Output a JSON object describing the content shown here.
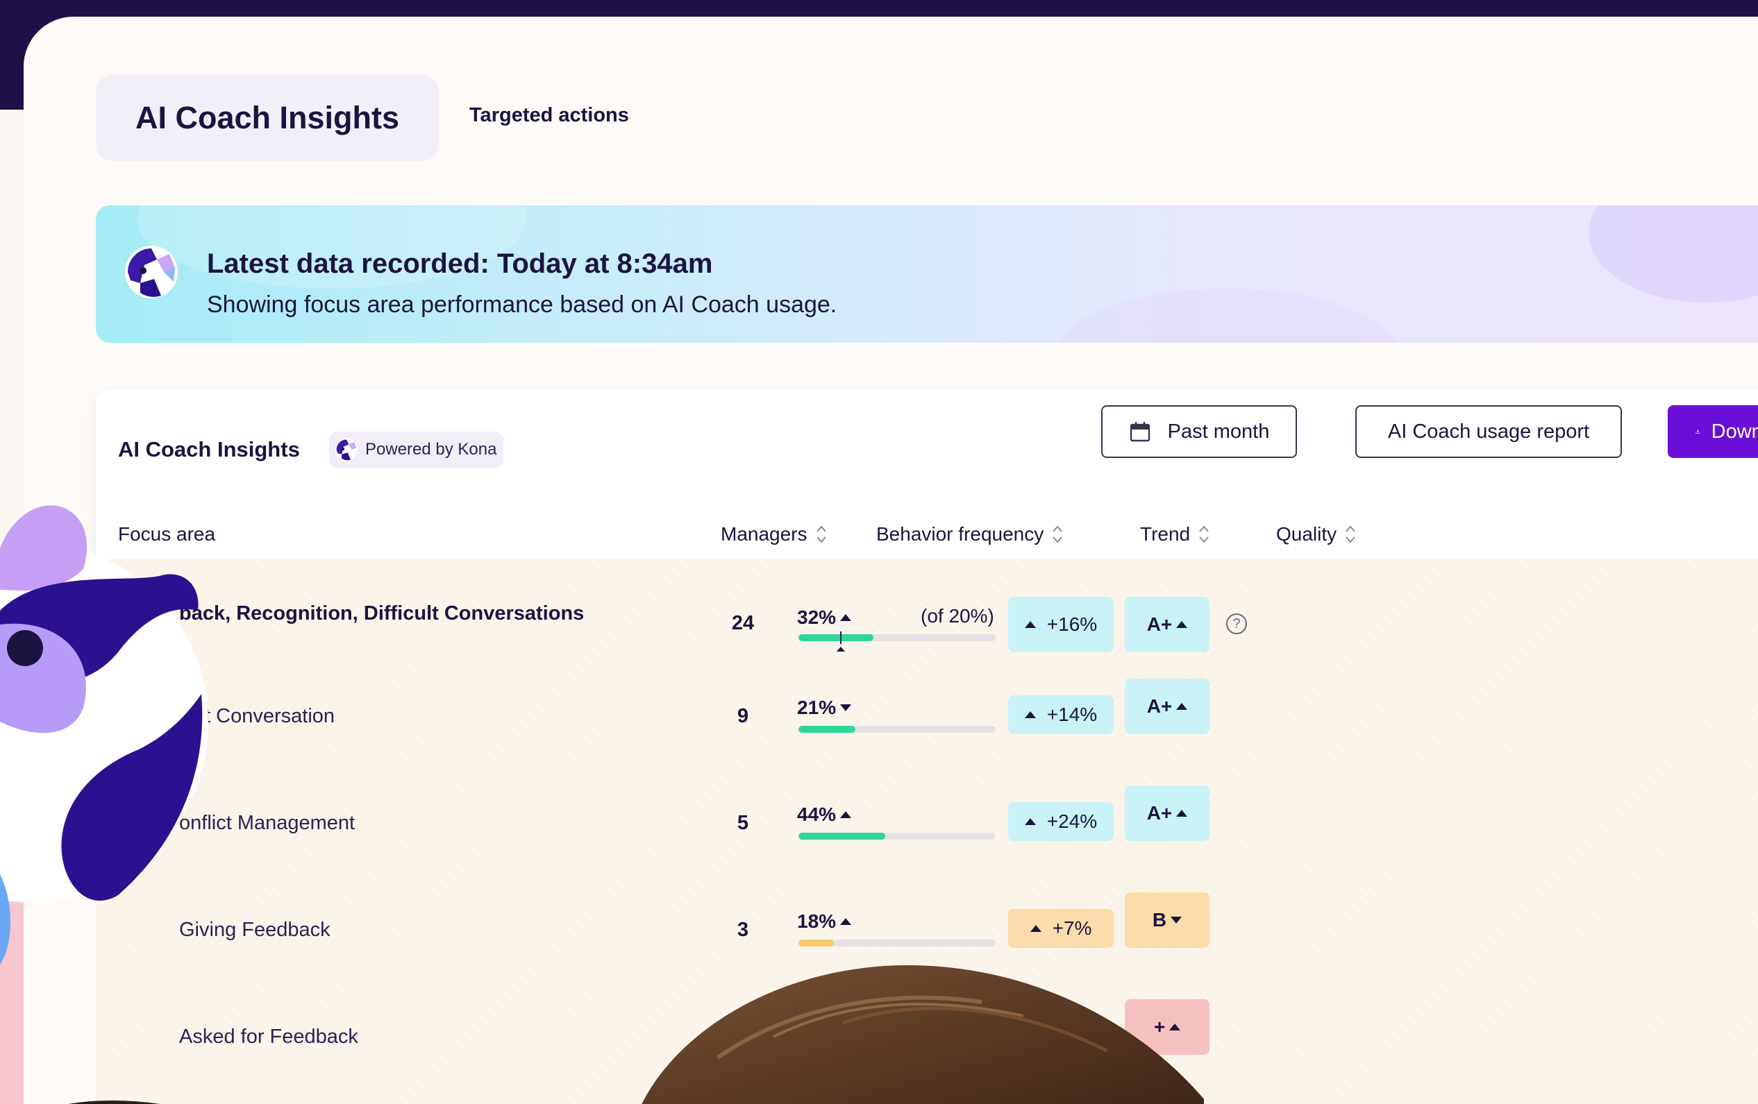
{
  "tabs": {
    "active": "AI Coach Insights",
    "other": "Targeted actions"
  },
  "banner": {
    "title": "Latest data recorded: Today at 8:34am",
    "subtitle": "Showing focus area performance based on AI Coach usage."
  },
  "panel": {
    "title": "AI Coach Insights",
    "powered": "Powered by Kona",
    "date_range": "Past month",
    "usage_report": "AI Coach usage report",
    "download": "Download PD"
  },
  "columns": {
    "focus_area": "Focus area",
    "managers": "Managers",
    "behavior_frequency": "Behavior frequency",
    "trend": "Trend",
    "quality": "Quality"
  },
  "rows": [
    {
      "name": "back, Recognition, Difficult Conversations",
      "managers": "24",
      "pct": "32%",
      "pct_dir": "up",
      "of": "(of 20%)",
      "fill": 0.38,
      "fill_color": "#2fd69a",
      "trend": "+16%",
      "trend_bg": "#c9f2f6",
      "quality": "A+",
      "quality_dir": "up",
      "quality_bg": "#c9f2f6"
    },
    {
      "name": "cult Conversation",
      "managers": "9",
      "pct": "21%",
      "pct_dir": "down",
      "of": "",
      "fill": 0.29,
      "fill_color": "#2fd69a",
      "trend": "+14%",
      "trend_bg": "#c9f2f6",
      "quality": "A+",
      "quality_dir": "up",
      "quality_bg": "#c9f2f6"
    },
    {
      "name": "onflict Management",
      "managers": "5",
      "pct": "44%",
      "pct_dir": "up",
      "of": "",
      "fill": 0.44,
      "fill_color": "#2fd69a",
      "trend": "+24%",
      "trend_bg": "#c9f2f6",
      "quality": "A+",
      "quality_dir": "up",
      "quality_bg": "#c9f2f6"
    },
    {
      "name": "Giving Feedback",
      "managers": "3",
      "pct": "18%",
      "pct_dir": "up",
      "of": "",
      "fill": 0.18,
      "fill_color": "#f6c96b",
      "trend": "+7%",
      "trend_bg": "#fbdcaa",
      "quality": "B",
      "quality_dir": "down",
      "quality_bg": "#fbdcaa"
    },
    {
      "name": "Asked for Feedback",
      "managers": "",
      "pct": "",
      "pct_dir": "",
      "of": "",
      "fill": 0,
      "fill_color": "#f6c96b",
      "trend": "",
      "trend_bg": "transparent",
      "quality": "+",
      "quality_dir": "up",
      "quality_bg": "#f7c0c0"
    }
  ],
  "icons": {
    "calendar": "calendar-icon",
    "download": "download-icon",
    "sort": "sort-icon",
    "help": "help-icon",
    "logo": "kona-logo-icon"
  },
  "colors": {
    "accent": "#6a0fd8",
    "positive_fill": "#2fd69a",
    "warning_fill": "#f6c96b",
    "cyan_badge": "#c9f2f6",
    "amber_badge": "#fbdcaa"
  }
}
